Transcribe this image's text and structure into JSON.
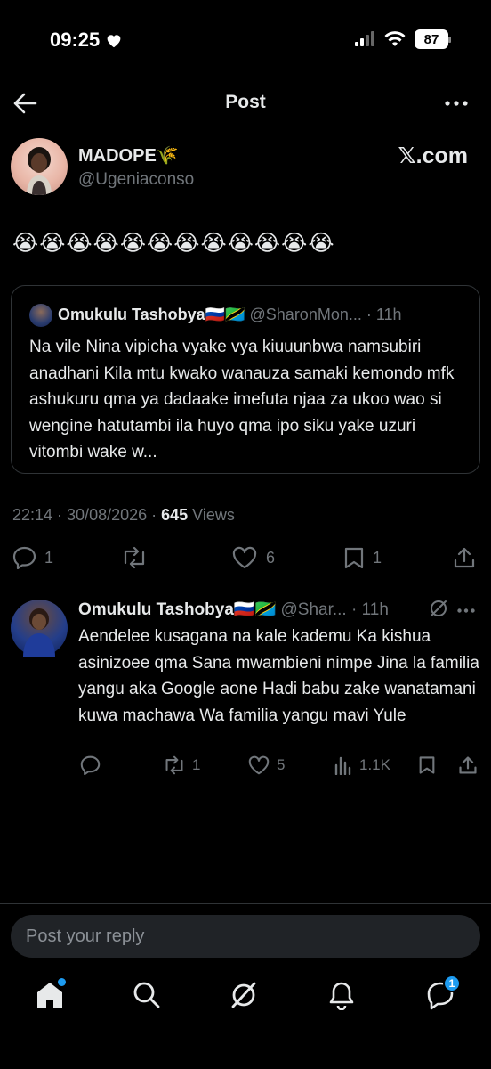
{
  "status_bar": {
    "time": "09:25",
    "battery": "87"
  },
  "header": {
    "title": "Post"
  },
  "post": {
    "author_name": "MADOPE🌾",
    "author_handle": "@Ugeniaconso",
    "watermark": "𝕏.com",
    "text": "😭😭😭😭😭😭😭😭😭😭😭😭",
    "timestamp": "22:14 · 30/08/2026 · ",
    "views_count": "645",
    "views_label": " Views",
    "replies": "1",
    "reposts": "",
    "likes": "6",
    "bookmarks": "1"
  },
  "quote": {
    "name": "Omukulu Tashobya🇷🇺🇹🇿",
    "handle": " @SharonMon... · 11h",
    "text": "Na vile Nina vipicha vyake vya kiuuunbwa namsubiri anadhani Kila mtu kwako wanauza samaki kemondo mfk ashukuru qma ya dadaake imefuta njaa za ukoo wao si wengine hatutambi ila huyo qma ipo siku yake uzuri vitombi wake w..."
  },
  "reply": {
    "name": "Omukulu Tashobya🇷🇺🇹🇿",
    "handle": " @Shar... · 11h",
    "text": "Aendelee kusagana na kale kademu Ka kishua asinizoee qma Sana mwambieni nimpe Jina la familia yangu aka Google aone Hadi babu zake wanatamani kuwa machawa Wa familia yangu mavi Yule",
    "replies": "",
    "reposts": "1",
    "likes": "5",
    "views": "1.1K"
  },
  "composer": {
    "placeholder": "Post your reply"
  },
  "tabbar": {
    "messages_badge": "1"
  },
  "colors": {
    "accent": "#1d9bf0",
    "background": "#000000",
    "muted": "#71767b",
    "divider": "#2f3336"
  }
}
